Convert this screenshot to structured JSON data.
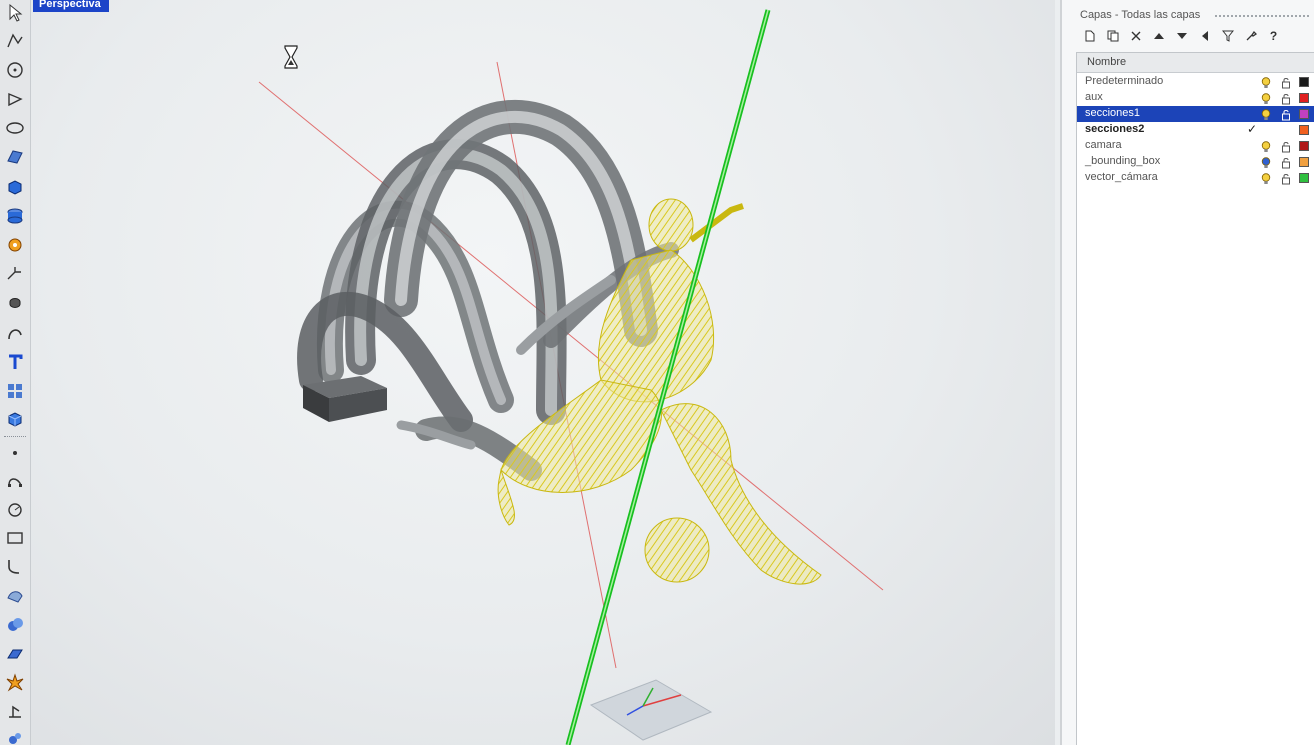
{
  "viewport": {
    "label": "Perspectiva"
  },
  "toolbar": {
    "tools": [
      "select-arrow-icon",
      "polyline-icon",
      "circle-icon",
      "polygon-icon",
      "ellipse-icon",
      "surface-icon",
      "box-solid-icon",
      "cylinder-icon",
      "gear-transform-icon",
      "dimension-icon",
      "blob-icon",
      "curve-icon",
      "text-icon",
      "array-icon",
      "cube-icon",
      "point-icon",
      "curve-edit-icon",
      "circle-snap-icon",
      "rectangle-icon",
      "fillet-icon",
      "loft-icon",
      "boolean-icon",
      "plane-icon",
      "explode-icon",
      "analyze-icon",
      "render-icon"
    ]
  },
  "layers_panel": {
    "title": "Capas - Todas las capas",
    "column_name": "Nombre",
    "toolbar": [
      "new-layer-icon",
      "new-sublayer-icon",
      "delete-icon",
      "move-up-icon",
      "move-down-icon",
      "move-left-icon",
      "filter-icon",
      "tools-icon",
      "help-icon"
    ],
    "help_label": "?",
    "layers": [
      {
        "name": "Predeterminado",
        "color": "#1a1a1a",
        "selected": false,
        "current": false
      },
      {
        "name": "aux",
        "color": "#e02020",
        "selected": false,
        "current": false
      },
      {
        "name": "secciones1",
        "color": "#c040c0",
        "selected": true,
        "current": false
      },
      {
        "name": "secciones2",
        "color": "#f06020",
        "selected": false,
        "current": true
      },
      {
        "name": "camara",
        "color": "#b01818",
        "selected": false,
        "current": false
      },
      {
        "name": "_bounding_box",
        "color": "#f0a040",
        "selected": false,
        "current": false
      },
      {
        "name": "vector_cámara",
        "color": "#30c040",
        "selected": false,
        "current": false
      }
    ],
    "current_mark": "✓"
  }
}
